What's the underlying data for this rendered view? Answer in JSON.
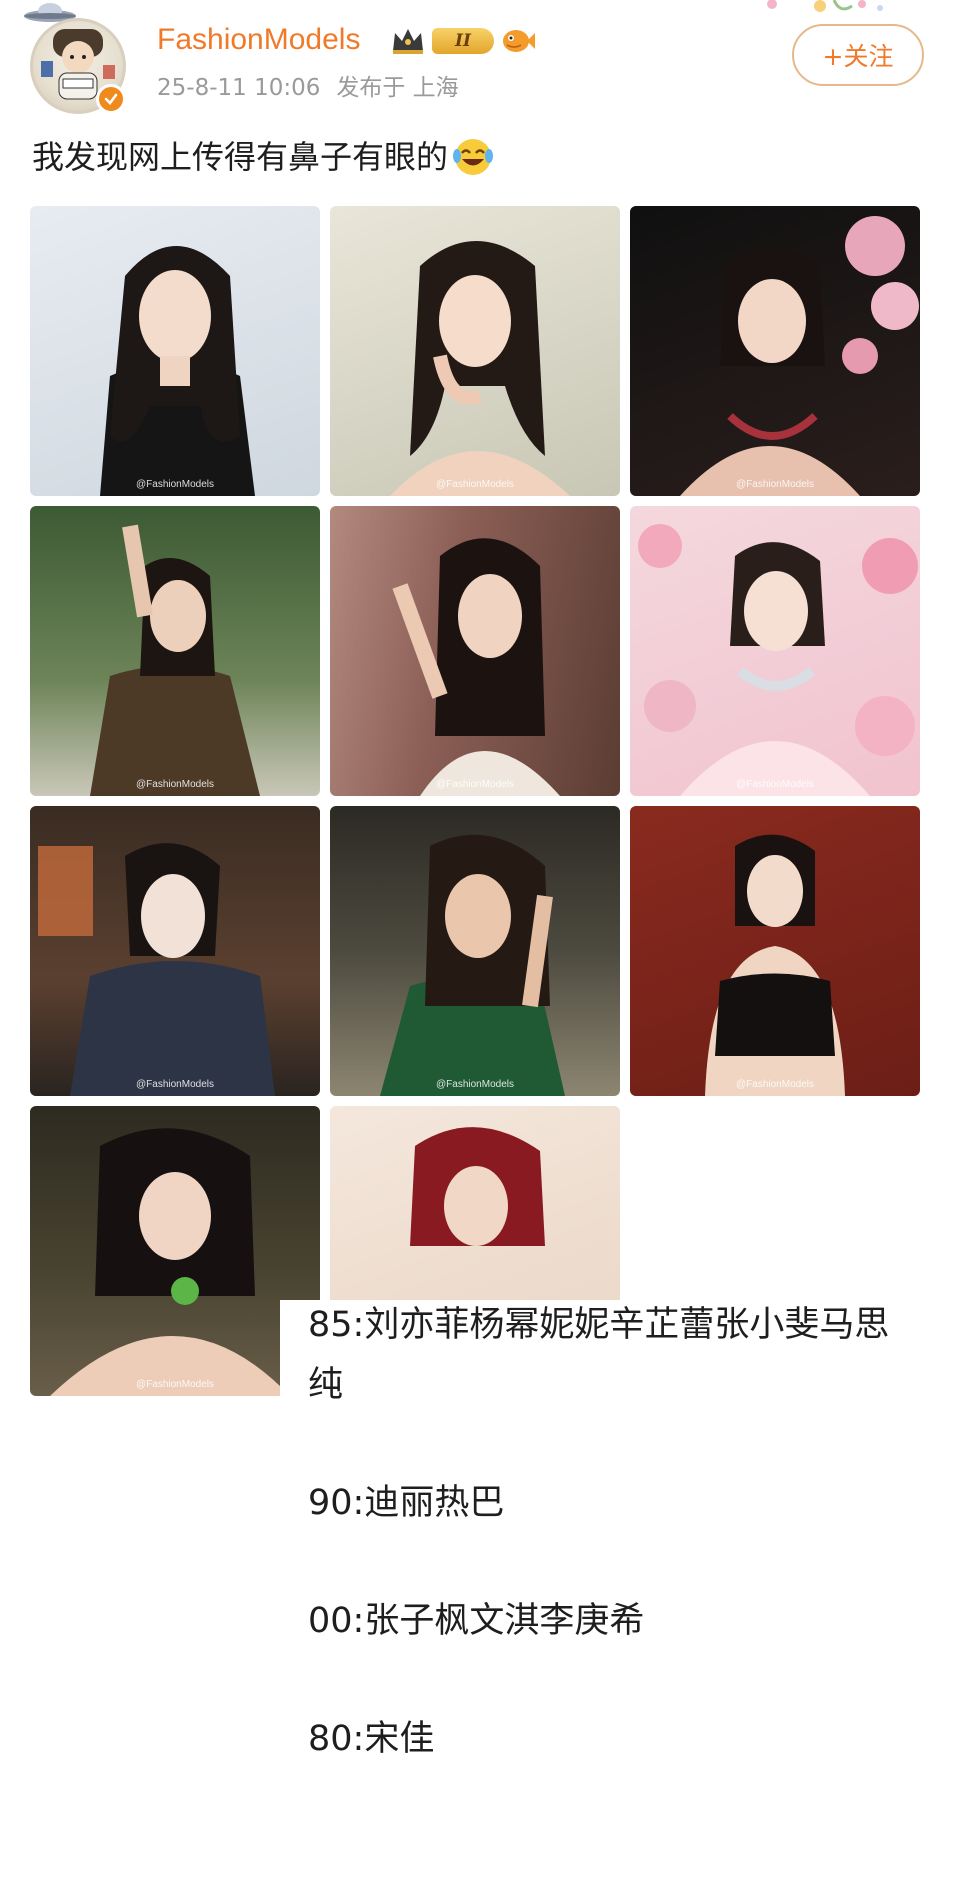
{
  "header": {
    "username": "FashionModels",
    "level_badge": "II",
    "timestamp": "25-8-11 10:06",
    "location": "发布于 上海",
    "follow_label": "+关注",
    "icons": [
      "crown-icon",
      "level-badge",
      "fish-icon",
      "verified-icon"
    ]
  },
  "post": {
    "text": "我发现网上传得有鼻子有眼的",
    "emoji": "laugh-cry-icon"
  },
  "photos": {
    "watermark": "@FashionModels",
    "count": 11
  },
  "overlay": {
    "line1": "85:刘亦菲杨幂妮妮辛芷蕾张小斐马思",
    "line1b": "纯",
    "line2": "90:迪丽热巴",
    "line3": "00:张子枫文淇李庚希",
    "line4": "80:宋佳"
  },
  "colors": {
    "accent": "#f07a2a",
    "meta_gray": "#9a9a9a",
    "follow_border": "#e6b98a"
  }
}
